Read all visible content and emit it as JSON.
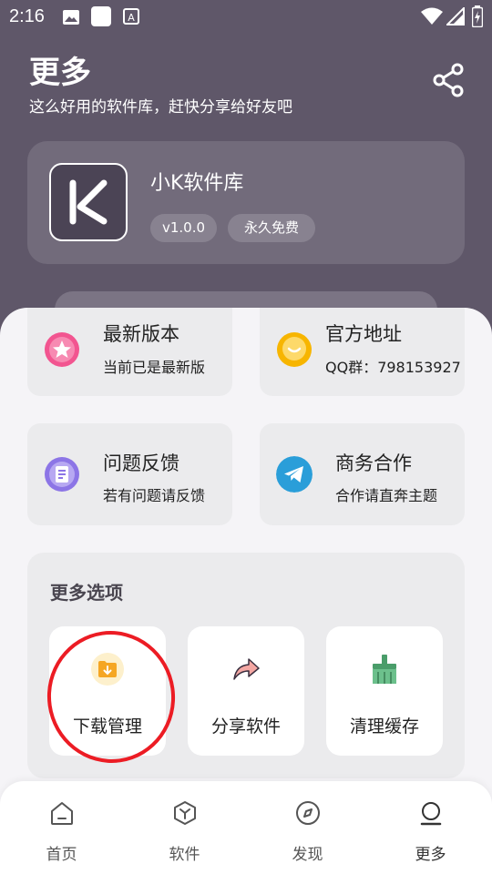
{
  "status_bar": {
    "time": "2:16",
    "notification_icons": [
      "image-icon",
      "app-icon",
      "a-icon"
    ],
    "system_icons": [
      "wifi-icon",
      "signal-icon",
      "battery-icon"
    ]
  },
  "header": {
    "title": "更多",
    "subtitle": "这么好用的软件库，赶快分享给好友吧",
    "share_icon": "share-icon",
    "background_color": "#5f5769"
  },
  "app_card": {
    "name": "小K软件库",
    "version": "v1.0.0",
    "tag": "永久免费"
  },
  "info_cards": [
    {
      "title": "最新版本",
      "subtitle": "当前已是最新版",
      "icon": "star-icon",
      "color": "#f25590"
    },
    {
      "title": "官方地址",
      "subtitle": "QQ群：798153927",
      "icon": "chat-bubble-icon",
      "color": "#f7b500"
    },
    {
      "title": "问题反馈",
      "subtitle": "若有问题请反馈",
      "icon": "feedback-icon",
      "color": "#8c75e6"
    },
    {
      "title": "商务合作",
      "subtitle": "合作请直奔主题",
      "icon": "telegram-icon",
      "color": "#2a9ed9"
    }
  ],
  "more_options": {
    "title": "更多选项",
    "items": [
      {
        "label": "下载管理",
        "icon": "download-folder-icon"
      },
      {
        "label": "分享软件",
        "icon": "share-arrow-icon"
      },
      {
        "label": "清理缓存",
        "icon": "broom-icon"
      }
    ]
  },
  "bottom_nav": [
    {
      "label": "首页",
      "icon": "home-icon"
    },
    {
      "label": "软件",
      "icon": "cube-icon"
    },
    {
      "label": "发现",
      "icon": "compass-icon"
    },
    {
      "label": "更多",
      "icon": "user-icon"
    }
  ]
}
